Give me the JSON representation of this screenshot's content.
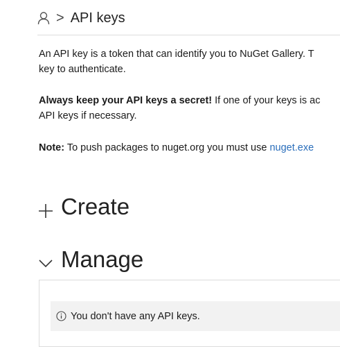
{
  "breadcrumb": {
    "separator": ">",
    "title": "API keys"
  },
  "intro": {
    "line1": "An API key is a token that can identify you to NuGet Gallery. T",
    "line2": "key to authenticate."
  },
  "secret": {
    "bold": "Always keep your API keys a secret!",
    "rest": " If one of your keys is ac",
    "line2": "API keys if necessary."
  },
  "note": {
    "bold": "Note:",
    "text": " To push packages to nuget.org you must use ",
    "link": "nuget.exe"
  },
  "sections": {
    "create_label": "Create",
    "manage_label": "Manage"
  },
  "manage": {
    "empty_message": "You don't have any API keys."
  },
  "icons": {
    "user": "user-icon",
    "create": "plus-icon",
    "manage": "chevron-down-icon",
    "info": "info-icon"
  },
  "colors": {
    "link": "#2a6ebb",
    "notice_bg": "#f2f2f2",
    "border": "#dcdcdc"
  }
}
